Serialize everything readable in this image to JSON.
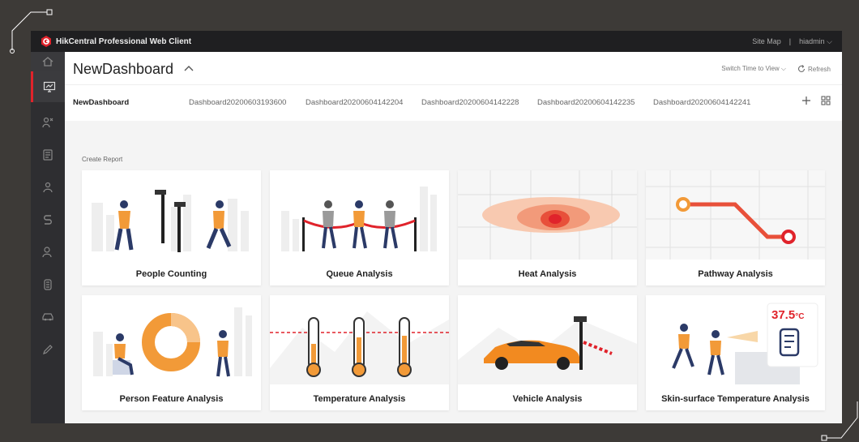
{
  "window": {
    "app_title": "HikCentral Professional Web Client",
    "site_map": "Site Map",
    "separator": "|",
    "user": "hiadmin"
  },
  "sidebar": {
    "items": [
      {
        "name": "home-icon"
      },
      {
        "name": "dashboard-icon",
        "active": true
      },
      {
        "name": "people-analysis-icon"
      },
      {
        "name": "map-icon"
      },
      {
        "name": "group-icon"
      },
      {
        "name": "pathway-icon"
      },
      {
        "name": "person-icon"
      },
      {
        "name": "temperature-icon"
      },
      {
        "name": "vehicle-icon"
      },
      {
        "name": "pen-icon"
      }
    ]
  },
  "header": {
    "title": "NewDashboard",
    "switch_time": "Switch Time to View",
    "refresh": "Refresh"
  },
  "tabs": [
    {
      "label": "NewDashboard",
      "active": true
    },
    {
      "label": "Dashboard20200603193600"
    },
    {
      "label": "Dashboard20200604142204"
    },
    {
      "label": "Dashboard20200604142228"
    },
    {
      "label": "Dashboard20200604142235"
    },
    {
      "label": "Dashboard20200604142241"
    }
  ],
  "section": {
    "title": "Create Report"
  },
  "cards": [
    {
      "label": "People Counting"
    },
    {
      "label": "Queue Analysis"
    },
    {
      "label": "Heat Analysis"
    },
    {
      "label": "Pathway Analysis"
    },
    {
      "label": "Person Feature Analysis"
    },
    {
      "label": "Temperature Analysis"
    },
    {
      "label": "Vehicle Analysis"
    },
    {
      "label": "Skin-surface Temperature Analysis",
      "temp_readout": "37.5",
      "temp_unit": "°C"
    }
  ],
  "colors": {
    "accent": "#e0232b",
    "orange": "#f29a38",
    "navy": "#2b3a67",
    "sidebar": "#2e2e31",
    "topbar": "#1f1f21"
  }
}
